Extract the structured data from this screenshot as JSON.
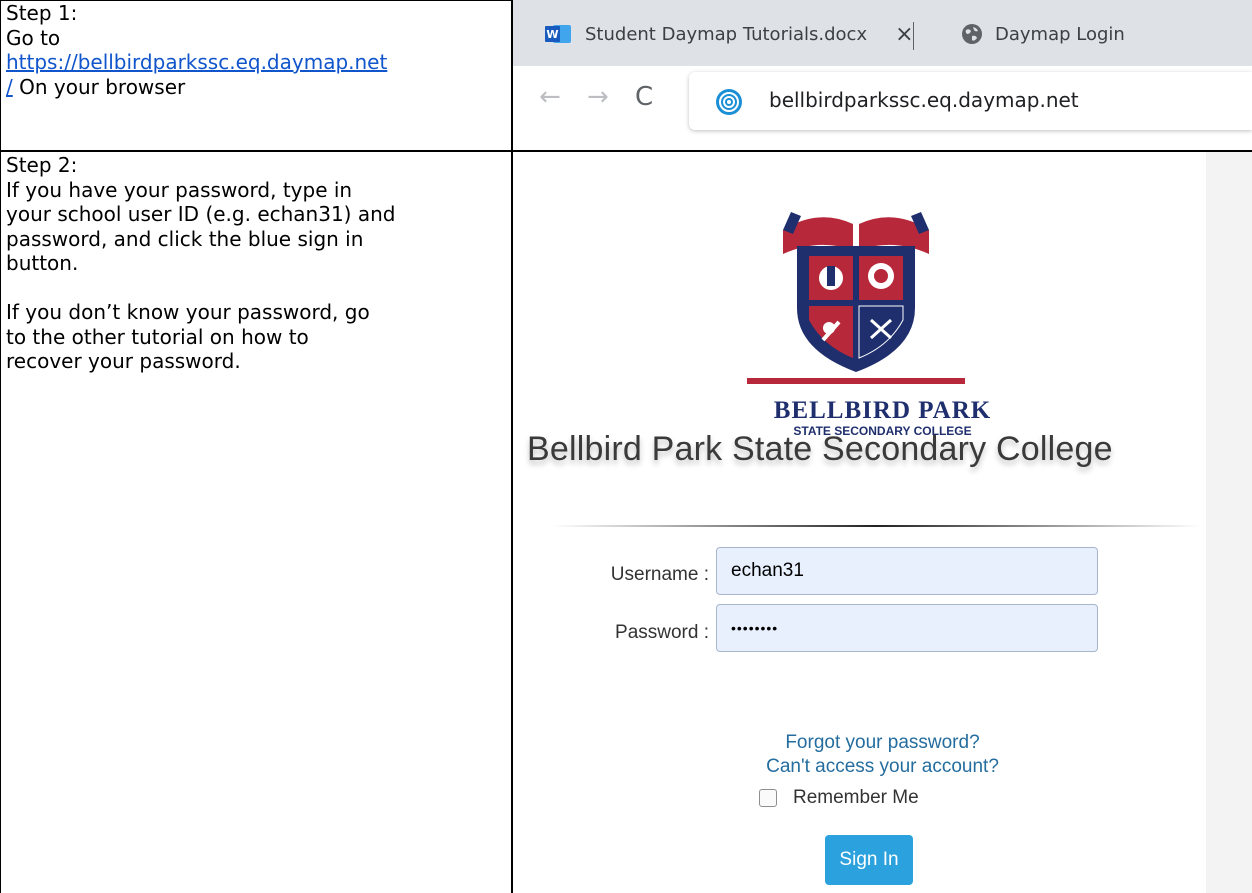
{
  "step1": {
    "heading": "Step 1:",
    "line1": "Go to",
    "url_part1": "https://bellbirdparkssc.eq.daymap.net",
    "url_part2": "/",
    "suffix": " On your browser"
  },
  "step2": {
    "heading": "Step 2:",
    "para1_lines": [
      "If you have your password, type in",
      "your school user ID (e.g. echan31) and",
      "password, and click the blue sign in",
      "button."
    ],
    "para2_lines": [
      "If you don’t know your password, go",
      "to the other tutorial on how to",
      "recover your password."
    ]
  },
  "browser": {
    "tabs": [
      {
        "label": "Student Daymap Tutorials.docx",
        "close": "×"
      },
      {
        "label": "Daymap Login"
      }
    ],
    "nav": {
      "back": "←",
      "forward": "→",
      "reload": "C"
    },
    "address": "bellbirdparkssc.eq.daymap.net"
  },
  "login": {
    "logo_name": "BELLBIRD PARK",
    "logo_sub": "STATE SECONDARY COLLEGE",
    "college_name": "Bellbird Park State Secondary College",
    "username_label": "Username :",
    "username_value": "echan31",
    "password_label": "Password :",
    "password_value": "••••••••",
    "forgot_link": "Forgot your password?",
    "access_link": "Can't access your account?",
    "remember_label": "Remember Me",
    "signin_label": "Sign In"
  },
  "colors": {
    "link": "#1155cc",
    "signin": "#2ba1dd",
    "login_link": "#246d9e",
    "crest_red": "#b7293a",
    "crest_navy": "#1f2f6e"
  }
}
